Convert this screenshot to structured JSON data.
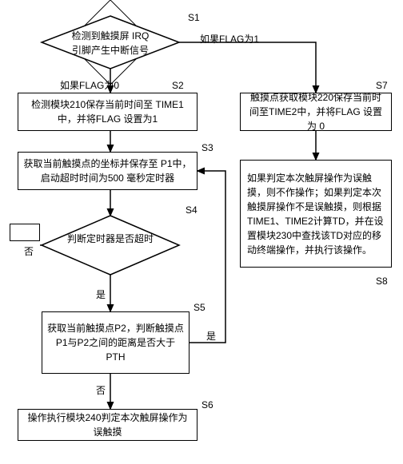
{
  "steps": {
    "s1": {
      "label": "S1",
      "text": "检测到触摸屏 IRQ\n引脚产生中断信号"
    },
    "s2": {
      "label": "S2",
      "text": "检测模块210保存当前时间至 TIME1中，并将FLAG 设置为1"
    },
    "s3": {
      "label": "S3",
      "text": "获取当前触摸点的坐标并保存至 P1中，启动超时时间为500 毫秒定时器"
    },
    "s4": {
      "label": "S4",
      "text": "判断定时器是否超时"
    },
    "s5": {
      "label": "S5",
      "text": "获取当前触摸点P2，判断触摸点P1与P2之间的距离是否大于PTH"
    },
    "s6": {
      "label": "S6",
      "text": "操作执行模块240判定本次触屏操作为误触摸"
    },
    "s7": {
      "label": "S7",
      "text": "触摸点获取模块220保存当前时间至TIME2中，并将FLAG 设置为 0"
    },
    "s8": {
      "label": "S8",
      "text": "如果判定本次触屏操作为误触摸，则不作操作；如果判定本次触摸屏操作不是误触摸，则根据TIME1、TIME2计算TD，并在设置模块230中查找该TD对应的移动终端操作，并执行该操作。"
    }
  },
  "branches": {
    "flag1": "如果FLAG为1",
    "flag0": "如果FLAG为0",
    "yes": "是",
    "no": "否"
  },
  "chart_data": {
    "type": "flowchart",
    "nodes": [
      {
        "id": "S1",
        "shape": "decision",
        "text": "检测到触摸屏 IRQ 引脚产生中断信号"
      },
      {
        "id": "S2",
        "shape": "process",
        "text": "检测模块210保存当前时间至 TIME1 中，并将FLAG 设置为1"
      },
      {
        "id": "S3",
        "shape": "process",
        "text": "获取当前触摸点的坐标并保存至 P1 中，启动超时时间为500 毫秒定时器"
      },
      {
        "id": "S4",
        "shape": "decision",
        "text": "判断定时器是否超时"
      },
      {
        "id": "S5",
        "shape": "process",
        "text": "获取当前触摸点P2，判断触摸点P1与P2之间的距离是否大于PTH"
      },
      {
        "id": "S6",
        "shape": "process",
        "text": "操作执行模块240判定本次触屏操作为误触摸"
      },
      {
        "id": "S7",
        "shape": "process",
        "text": "触摸点获取模块220保存当前时间至TIME2中，并将FLAG 设置为 0"
      },
      {
        "id": "S8",
        "shape": "process",
        "text": "如果判定本次触屏操作为误触摸，则不作操作；如果判定本次触摸屏操作不是误触摸，则根据TIME1、TIME2计算TD，并在设置模块230中查找该TD对应的移动终端操作，并执行该操作。"
      }
    ],
    "edges": [
      {
        "from": "S1",
        "to": "S7",
        "label": "如果FLAG为1"
      },
      {
        "from": "S1",
        "to": "S2",
        "label": "如果FLAG为0"
      },
      {
        "from": "S2",
        "to": "S3"
      },
      {
        "from": "S3",
        "to": "S4"
      },
      {
        "from": "S4",
        "to": "S4",
        "label": "否",
        "note": "loop/wait"
      },
      {
        "from": "S4",
        "to": "S5",
        "label": "是"
      },
      {
        "from": "S5",
        "to": "S3",
        "label": "是"
      },
      {
        "from": "S5",
        "to": "S6",
        "label": "否"
      },
      {
        "from": "S7",
        "to": "S8"
      }
    ]
  }
}
